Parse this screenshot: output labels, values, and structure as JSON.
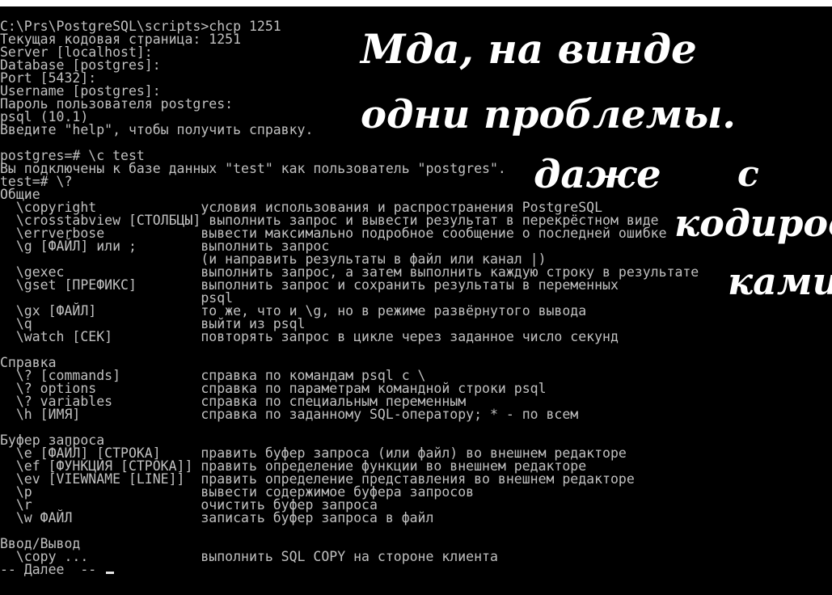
{
  "console": {
    "lines": [
      "C:\\Prs\\PostgreSQL\\scripts>chcp 1251",
      "Текущая кодовая страница: 1251",
      "Server [localhost]:",
      "Database [postgres]:",
      "Port [5432]:",
      "Username [postgres]:",
      "Пароль пользователя postgres:",
      "psql (10.1)",
      "Введите \"help\", чтобы получить справку.",
      "",
      "postgres=# \\c test",
      "Вы подключены к базе данных \"test\" как пользователь \"postgres\".",
      "test=# \\?",
      "Общие",
      "  \\copyright             условия использования и распространения PostgreSQL",
      "  \\crosstabview [СТОЛБЦЫ] выполнить запрос и вывести результат в перекрёстном виде",
      "  \\errverbose            вывести максимально подробное сообщение о последней ошибке",
      "  \\g [ФАЙЛ] или ;        выполнить запрос",
      "                         (и направить результаты в файл или канал |)",
      "  \\gexec                 выполнить запрос, а затем выполнить каждую строку в результате",
      "  \\gset [ПРЕФИКС]        выполнить запрос и сохранить результаты в переменных",
      "                         psql",
      "  \\gx [ФАЙЛ]             то же, что и \\g, но в режиме развёрнутого вывода",
      "  \\q                     выйти из psql",
      "  \\watch [СЕК]           повторять запрос в цикле через заданное число секунд",
      "",
      "Справка",
      "  \\? [commands]          справка по командам psql c \\",
      "  \\? options             справка по параметрам командной строки psql",
      "  \\? variables           справка по специальным переменным",
      "  \\h [ИМЯ]               справка по заданному SQL-оператору; * - по всем",
      "",
      "Буфер запроса",
      "  \\e [ФАЙЛ] [СТРОКА]     править буфер запроса (или файл) во внешнем редакторе",
      "  \\ef [ФУНКЦИЯ [СТРОКА]] править определение функции во внешнем редакторе",
      "  \\ev [VIEWNAME [LINE]]  править определение представления во внешнем редакторе",
      "  \\p                     вывести содержимое буфера запросов",
      "  \\r                     очистить буфер запроса",
      "  \\w ФАЙЛ                записать буфер запроса в файл",
      "",
      "Ввод/Вывод",
      "  \\copy ...              выполнить SQL COPY на стороне клиента",
      "-- Далее  -- "
    ]
  },
  "handwriting": {
    "line1": "Мда, на винде",
    "line2": "одни проблемы.",
    "line3": "даже",
    "line4": "с",
    "line5": "кодиров",
    "line6": "ками"
  },
  "colors": {
    "console_background": "#000000",
    "console_text": "#c0c0c0",
    "handwriting": "#ffffff"
  }
}
